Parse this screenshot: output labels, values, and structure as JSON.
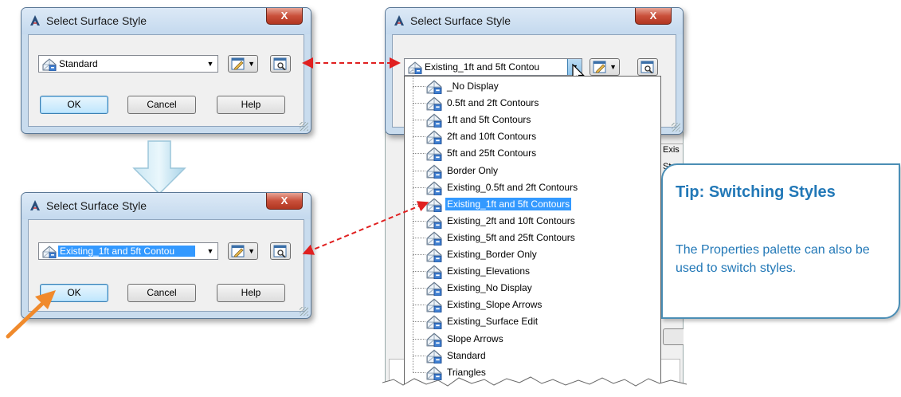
{
  "dialogs": {
    "top_left": {
      "title": "Select Surface Style",
      "close_label": "X",
      "combo_value": "Standard",
      "ok_label": "OK",
      "cancel_label": "Cancel",
      "help_label": "Help"
    },
    "bottom_left": {
      "title": "Select Surface Style",
      "close_label": "X",
      "combo_value": "Existing_1ft and 5ft Contou",
      "ok_label": "OK",
      "cancel_label": "Cancel",
      "help_label": "Help"
    },
    "right": {
      "title": "Select Surface Style",
      "close_label": "X",
      "combo_value": "Existing_1ft and 5ft Contou"
    }
  },
  "dropdown": {
    "items": [
      "_No Display",
      "0.5ft and 2ft Contours",
      "1ft and 5ft Contours",
      "2ft and 10ft Contours",
      "5ft and 25ft Contours",
      "Border Only",
      "Existing_0.5ft and 2ft Contours",
      "Existing_1ft and 5ft Contours",
      "Existing_2ft and 10ft Contours",
      "Existing_5ft and 25ft Contours",
      "Existing_Border Only",
      "Existing_Elevations",
      "Existing_No Display",
      "Existing_Slope Arrows",
      "Existing_Surface Edit",
      "Slope Arrows",
      "Standard",
      "Triangles"
    ],
    "selected_index": 7
  },
  "background_app": {
    "cell_1": "Exis",
    "cell_2": "St"
  },
  "tip": {
    "title": "Tip: Switching Styles",
    "body": "The Properties palette can also be used to switch styles."
  },
  "colors": {
    "selection": "#3399ff",
    "arrow_red": "#e02020",
    "tip_blue": "#2278b7",
    "orange_arrow": "#f08a2c"
  }
}
